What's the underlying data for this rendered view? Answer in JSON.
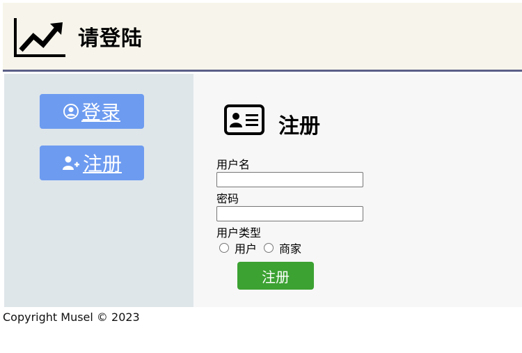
{
  "header": {
    "title": "请登陆",
    "logo_icon": "chart-line-up-icon",
    "background": "#f7f5eb",
    "rule_color": "#5a5f86"
  },
  "sidebar": {
    "background": "#dee6ea",
    "button_color": "#6d9bf0",
    "items": [
      {
        "label": "登录",
        "icon": "user-circle-icon"
      },
      {
        "label": "注册",
        "icon": "user-plus-icon"
      }
    ]
  },
  "main": {
    "title": "注册",
    "title_icon": "id-card-icon",
    "form": {
      "username_label": "用户名",
      "username_value": "",
      "password_label": "密码",
      "password_value": "",
      "user_type_label": "用户类型",
      "options": [
        "用户",
        "商家"
      ],
      "submit_label": "注册",
      "submit_color": "#3ca232"
    }
  },
  "footer": {
    "text": "Copyright Musel © 2023"
  }
}
